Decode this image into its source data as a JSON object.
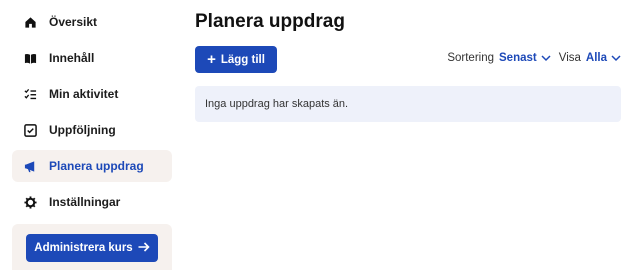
{
  "sidebar": {
    "items": [
      {
        "label": "Översikt",
        "icon": "home-icon"
      },
      {
        "label": "Innehåll",
        "icon": "book-icon"
      },
      {
        "label": "Min aktivitet",
        "icon": "checklist-icon"
      },
      {
        "label": "Uppföljning",
        "icon": "check-square-icon"
      },
      {
        "label": "Planera uppdrag",
        "icon": "megaphone-icon"
      },
      {
        "label": "Inställningar",
        "icon": "gear-icon"
      }
    ],
    "active_item": "Planera uppdrag",
    "admin_button": {
      "label": "Administrera kurs",
      "icon": "arrow-right-icon"
    }
  },
  "main": {
    "title": "Planera uppdrag",
    "add_button": {
      "label": "Lägg till",
      "icon": "plus-icon"
    },
    "sort": {
      "label": "Sortering",
      "value": "Senast"
    },
    "show": {
      "label": "Visa",
      "value": "Alla"
    },
    "empty_message": "Inga uppdrag har skapats än."
  },
  "colors": {
    "accent": "#1d49b8",
    "active_bg": "#f6f1ee",
    "empty_bg": "#eef1fa"
  }
}
